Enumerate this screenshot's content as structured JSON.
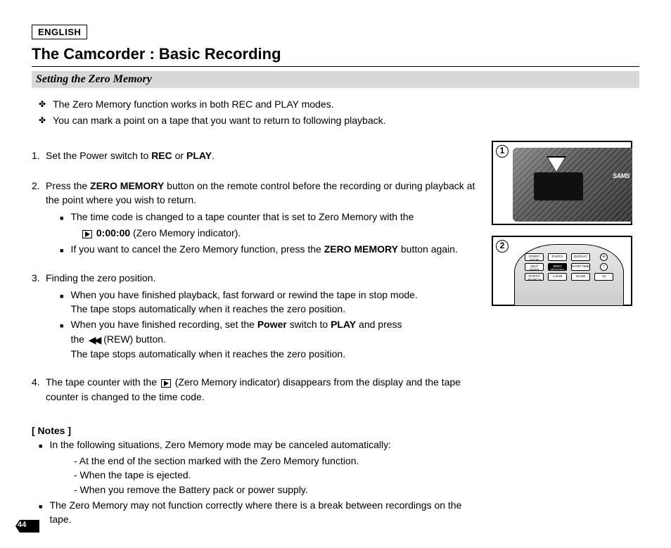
{
  "lang": "ENGLISH",
  "title": "The Camcorder : Basic Recording",
  "subtitle": "Setting the Zero Memory",
  "intro": [
    "The Zero Memory function works in both REC and PLAY modes.",
    "You can mark a point on a tape that you want to return to following playback."
  ],
  "steps": {
    "s1_pre": "Set the Power switch to ",
    "s1_b1": "REC",
    "s1_mid": " or ",
    "s1_b2": "PLAY",
    "s1_post": ".",
    "s2_pre": "Press the ",
    "s2_b1": "ZERO MEMORY",
    "s2_post": " button on the remote control before the recording or during playback at the point where you wish to return.",
    "s2a": "The time code is changed to a tape counter that is set to Zero Memory with the",
    "s2a_code": "0:00:00",
    "s2a_after": " (Zero Memory indicator).",
    "s2b_pre": "If you want to cancel the Zero Memory function, press the ",
    "s2b_b": "ZERO MEMORY",
    "s2b_post": " button again.",
    "s3": "Finding the zero position.",
    "s3a_l1": "When you have finished playback, fast forward or rewind the tape in stop mode.",
    "s3a_l2": "The tape stops automatically when it reaches the zero position.",
    "s3b_pre": "When you have finished recording, set the ",
    "s3b_b1": "Power",
    "s3b_mid": " switch to ",
    "s3b_b2": "PLAY",
    "s3b_post": " and press",
    "s3b_l2_pre": "the ",
    "s3b_l2_post": "(REW) button.",
    "s3b_l3": "The tape stops automatically when it reaches the zero position.",
    "s4_pre": "The tape counter with the ",
    "s4_post": "(Zero Memory indicator) disappears from the display and the tape counter is changed to the time code."
  },
  "notes_head": "[ Notes ]",
  "notes": {
    "n1": "In the following situations, Zero Memory mode may be canceled automatically:",
    "n1a": "- At the end of the section marked with the Zero Memory function.",
    "n1b": "- When the tape is ejected.",
    "n1c": "- When you remove the Battery pack or power supply.",
    "n2": "The Zero Memory may not function correctly where there is a break between recordings on the tape."
  },
  "fig": {
    "num1": "1",
    "num2": "2",
    "samsung": "SAMS"
  },
  "remote_btns": [
    "START/\nSTOP",
    "PHOTO",
    "DISPLAY",
    "W",
    "SELF\nTIMER",
    "ZERO\nMEMORY",
    "DATE/\nTIME",
    "T",
    "PHOTO\nSEARCH",
    "A.DUB",
    "SLOW",
    "X2"
  ],
  "page_number": "44"
}
